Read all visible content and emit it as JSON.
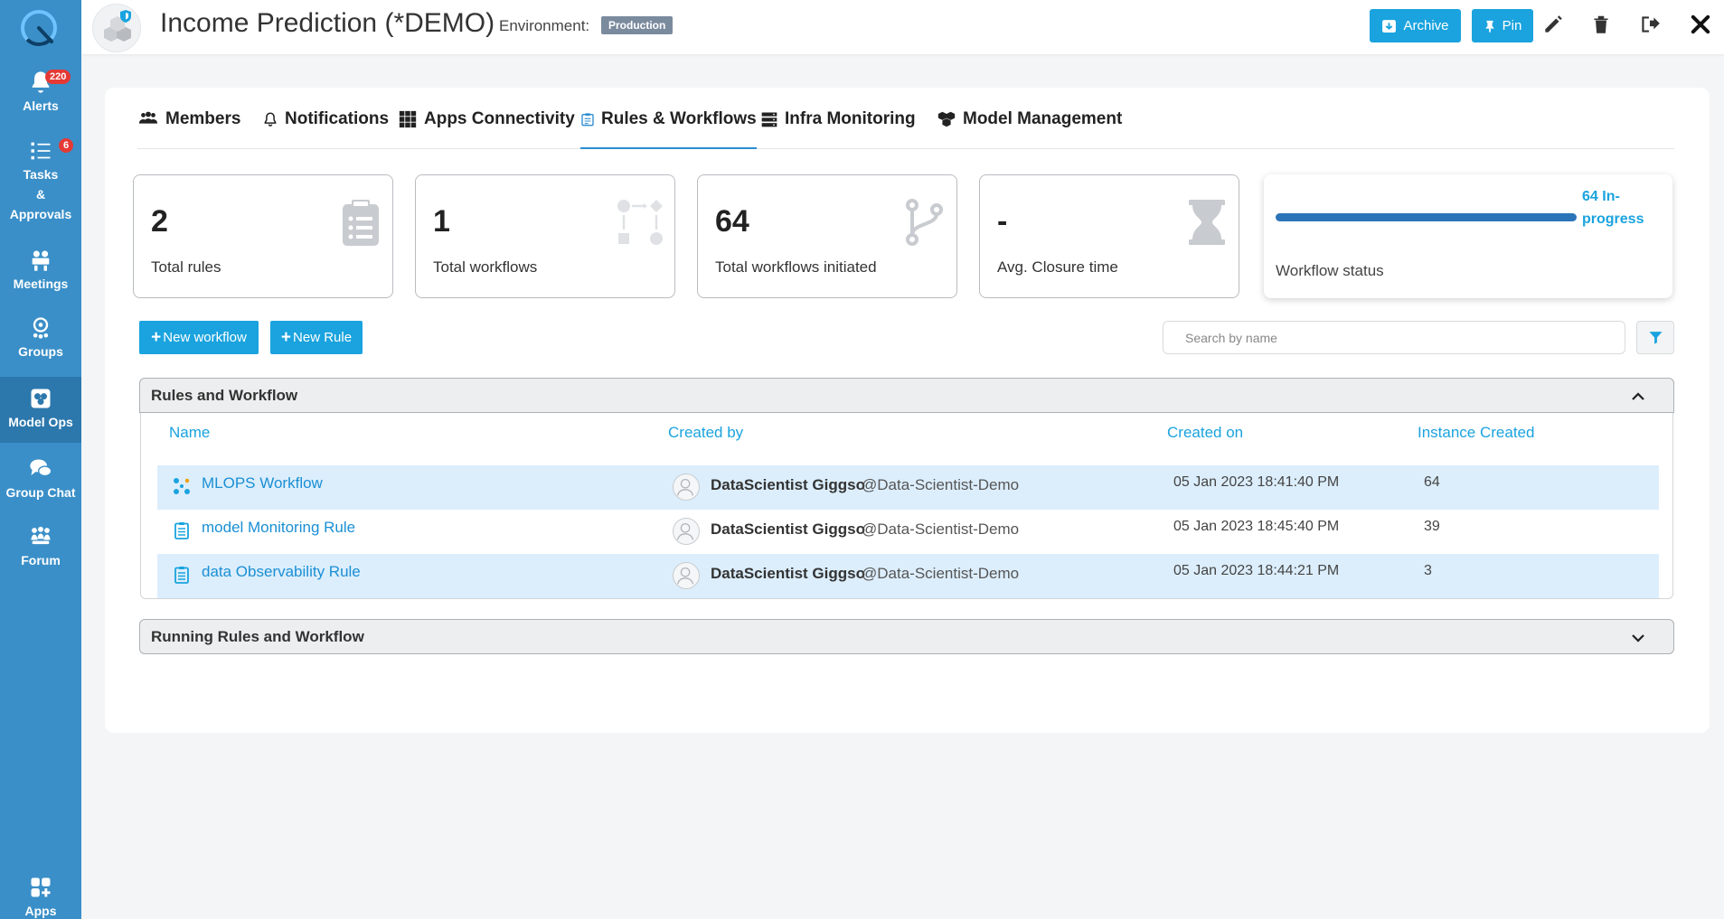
{
  "sidebar": {
    "items": [
      {
        "label": "Alerts",
        "badge": "220",
        "icon": "bell-icon"
      },
      {
        "label_lines": [
          "Tasks",
          "&",
          "Approvals"
        ],
        "badge": "6",
        "icon": "checklist-icon"
      },
      {
        "label": "Meetings",
        "icon": "meeting-icon"
      },
      {
        "label": "Groups",
        "icon": "groups-icon"
      },
      {
        "label": "Model Ops",
        "icon": "model-ops-icon",
        "active": true
      },
      {
        "label": "Group Chat",
        "icon": "chat-icon"
      },
      {
        "label": "Forum",
        "icon": "forum-icon"
      },
      {
        "label": "Apps",
        "icon": "apps-icon"
      }
    ]
  },
  "header": {
    "title": "Income Prediction (*DEMO)",
    "environment_label": "Environment:",
    "environment_value": "Production",
    "archive_label": "Archive",
    "pin_label": "Pin"
  },
  "tabs": [
    {
      "label": "Members",
      "icon": "members-icon"
    },
    {
      "label": "Notifications",
      "icon": "bell-outline-icon"
    },
    {
      "label": "Apps Connectivity",
      "icon": "grid-icon"
    },
    {
      "label": "Rules & Workflows",
      "icon": "clipboard-icon",
      "active": true
    },
    {
      "label": "Infra Monitoring",
      "icon": "server-icon"
    },
    {
      "label": "Model Management",
      "icon": "cubes-icon"
    }
  ],
  "stats": [
    {
      "value": "2",
      "label": "Total rules",
      "icon": "clipboard-list-icon"
    },
    {
      "value": "1",
      "label": "Total workflows",
      "icon": "workflow-diagram-icon"
    },
    {
      "value": "64",
      "label": "Total workflows initiated",
      "icon": "branch-icon"
    },
    {
      "value": "-",
      "label": "Avg. Closure time",
      "icon": "hourglass-icon"
    }
  ],
  "workflow_status": {
    "label": "Workflow status",
    "count_text": "64 In-progress",
    "in_progress_fraction": 1.0
  },
  "actions": {
    "new_workflow": "New workflow",
    "new_rule": "New Rule",
    "search_placeholder": "Search by name"
  },
  "rules_section": {
    "title": "Rules and Workflow",
    "columns": [
      "Name",
      "Created by",
      "Created on",
      "Instance Created"
    ],
    "rows": [
      {
        "name": "MLOPS Workflow",
        "type": "workflow",
        "icon": "workflow-icon",
        "created_by": "DataScientist Giggso",
        "handle": "@Data-Scientist-Demo",
        "created_on": "05 Jan 2023 18:41:40 PM",
        "instances": "64",
        "highlight": true
      },
      {
        "name": "model Monitoring Rule",
        "type": "rule",
        "icon": "rule-icon",
        "created_by": "DataScientist Giggso",
        "handle": "@Data-Scientist-Demo",
        "created_on": "05 Jan 2023 18:45:40 PM",
        "instances": "39",
        "highlight": false
      },
      {
        "name": "data Observability Rule",
        "type": "rule",
        "icon": "rule-icon",
        "created_by": "DataScientist Giggso",
        "handle": "@Data-Scientist-Demo",
        "created_on": "05 Jan 2023 18:44:21 PM",
        "instances": "3",
        "highlight": true
      }
    ]
  },
  "running_section": {
    "title": "Running Rules and Workflow"
  },
  "colors": {
    "sidebar": "#3a8fc8",
    "accent": "#1aa3de",
    "row_highlight": "#dceefc",
    "env_badge": "#7b8b9e"
  }
}
